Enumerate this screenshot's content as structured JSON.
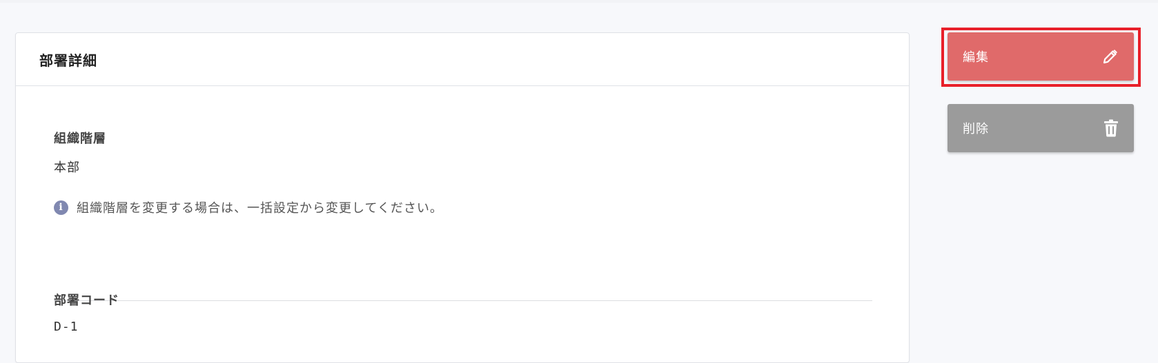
{
  "card": {
    "title": "部署詳細"
  },
  "fields": {
    "org_level": {
      "label": "組織階層",
      "value": "本部",
      "notice": "組織階層を変更する場合は、一括設定から変更してください。"
    },
    "dept_code": {
      "label": "部署コード",
      "value": "D-1"
    }
  },
  "actions": {
    "edit_label": "編集",
    "edit_icon": "pencil-icon",
    "delete_label": "削除",
    "delete_icon": "trash-icon"
  },
  "colors": {
    "edit_button": "#e06a6a",
    "delete_button": "#9b9b9b",
    "highlight": "#e8202a",
    "info_icon": "#8088b0"
  }
}
